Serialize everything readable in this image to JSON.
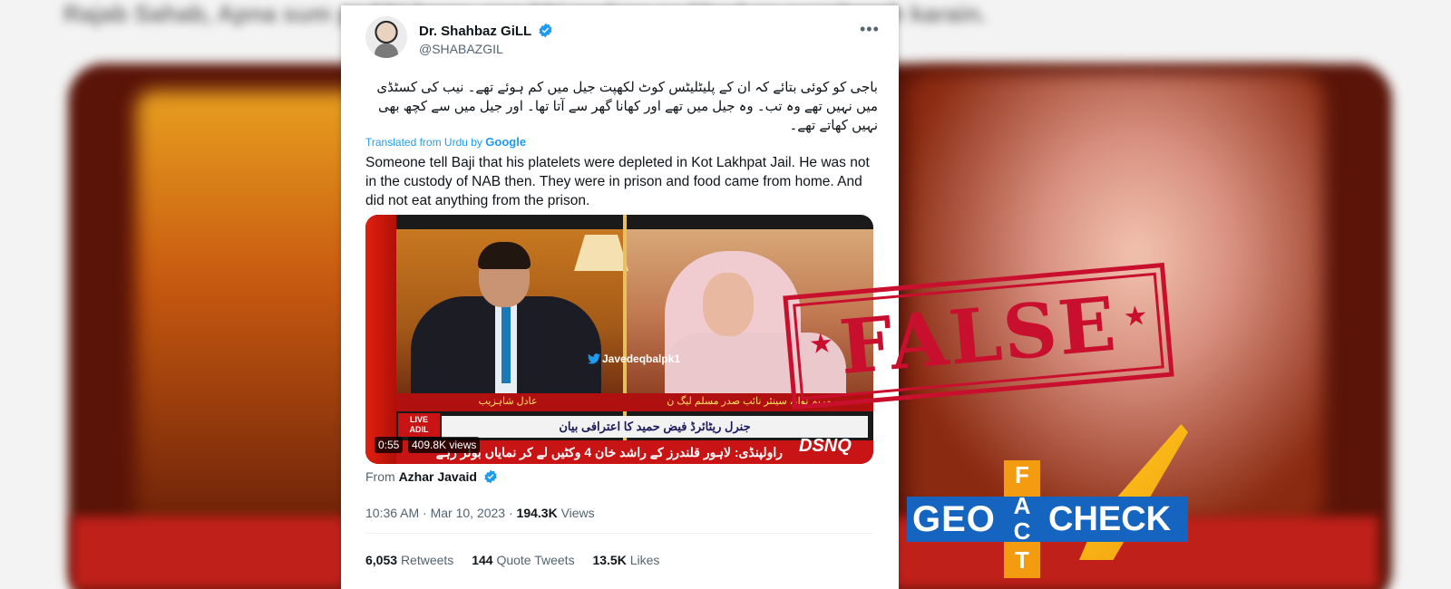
{
  "background": {
    "top_text": "Rajab Sahab, Apna sum pe bhi hoga, aap bhi nadaar sa khud se sangharsh karain."
  },
  "tweet": {
    "author_name": "Dr. Shahbaz GiLL",
    "author_handle": "@SHABAZGIL",
    "more_label": "•••",
    "urdu_text": "باجی کو کوئی بتائے کہ ان کے پلیٹلیٹس کوٹ لکھپت جیل میں کم ہوئے تھے۔ نیب کی کسٹڈی میں نہیں تھے وہ تب۔ وہ جیل میں تھے اور کھانا گھر سے آتا تھا۔ اور جیل میں سے کچھ بھی نہیں کھاتے تھے۔",
    "translated_label": "Translated from Urdu by",
    "translated_brand": "Google",
    "english_text": "Someone tell Baji that his platelets were depleted in Kot Lakhpat Jail. He was not in the custody of NAB then. They were in prison and food came from home. And did not eat anything from the prison.",
    "video": {
      "name_left": "عادل شاہزیب",
      "name_right": "مریم نواز، سینئر نائب صدر مسلم لیگ ن",
      "headline": "جنرل ریٹائرڈ فیض حمید کا اعترافی بیان",
      "ticker": "راولپنڈی: لاہور قلندرز کے راشد خان 4 وکٹیں لے کر نمایاں بولر رہے",
      "live_label": "LIVE",
      "live_sub": "ADIL",
      "channel_logo": "DSNQ",
      "watermark": "Javedeqbalpk1",
      "duration": "0:55",
      "views": "409.8K views"
    },
    "from_label": "From",
    "from_name": "Azhar Javaid",
    "time": "10:36 AM · Mar 10, 2023 ·",
    "views_count": "194.3K",
    "views_label": "Views",
    "stats": [
      {
        "value": "6,053",
        "label": "Retweets"
      },
      {
        "value": "144",
        "label": "Quote Tweets"
      },
      {
        "value": "13.5K",
        "label": "Likes"
      }
    ]
  },
  "stamp": {
    "text": "FALSE",
    "color": "#c8102e"
  },
  "logo": {
    "geo": "GEO",
    "check": "CHECK",
    "fact_letters": [
      "F",
      "A",
      "C",
      "T"
    ],
    "bar_color": "#1565c0",
    "accent_color": "#f39c12"
  },
  "colors": {
    "link_blue": "#1d9bf0",
    "text": "#0f1419",
    "muted": "#536471"
  }
}
